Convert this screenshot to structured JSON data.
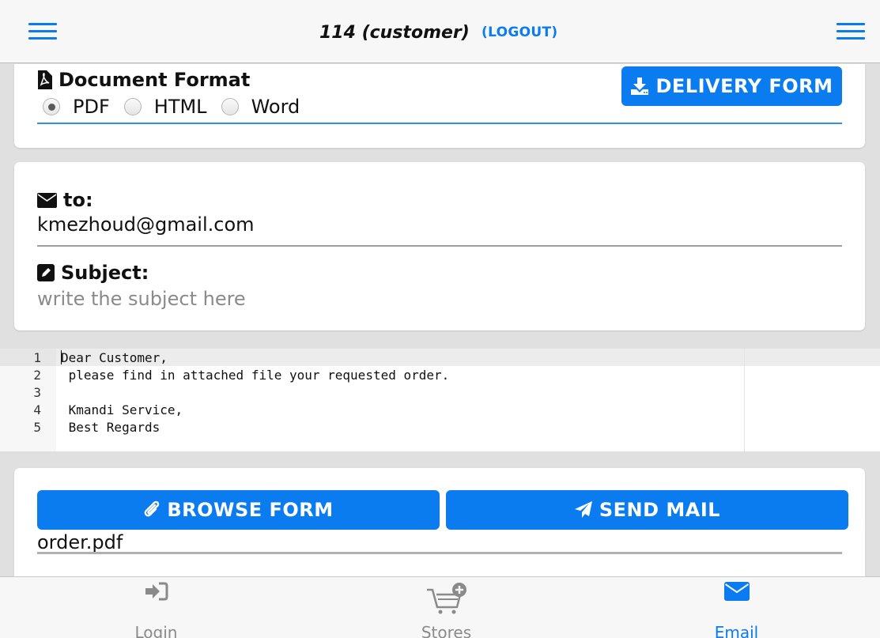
{
  "header": {
    "user_title": "114 (customer)",
    "logout_label": "(LOGOUT)",
    "left_menu_icon": "hamburger-icon",
    "right_menu_icon": "hamburger-icon"
  },
  "document_format": {
    "label": "Document Format",
    "icon": "file-pdf-icon",
    "options": [
      "PDF",
      "HTML",
      "Word"
    ],
    "selected": "PDF",
    "delivery_button_label": "DELIVERY FORM",
    "delivery_button_icon": "download-icon"
  },
  "mail": {
    "to_label": "to:",
    "to_icon": "envelope-icon",
    "to_value": "kmezhoud@gmail.com",
    "subject_label": "Subject:",
    "subject_icon": "edit-icon",
    "subject_placeholder": "write the subject here",
    "subject_value": ""
  },
  "editor": {
    "line_numbers": [
      "1",
      "2",
      "3",
      "4",
      "5"
    ],
    "lines": [
      "Dear Customer,",
      " please find in attached file your requested order.",
      "",
      " Kmandi Service,",
      " Best Regards"
    ]
  },
  "attachment": {
    "browse_label": "BROWSE FORM",
    "browse_icon": "paperclip-icon",
    "send_label": "SEND MAIL",
    "send_icon": "paper-plane-icon",
    "file_name": "order.pdf"
  },
  "bottom_nav": {
    "items": [
      {
        "label": "Login",
        "icon": "sign-in-icon",
        "active": false
      },
      {
        "label": "Stores",
        "icon": "cart-plus-icon",
        "active": false
      },
      {
        "label": "Email",
        "icon": "envelope-icon",
        "active": true
      }
    ]
  },
  "colors": {
    "accent": "#0a7cf0",
    "topbar_bg": "#f7f7f7",
    "page_bg": "#e0e0e0"
  }
}
